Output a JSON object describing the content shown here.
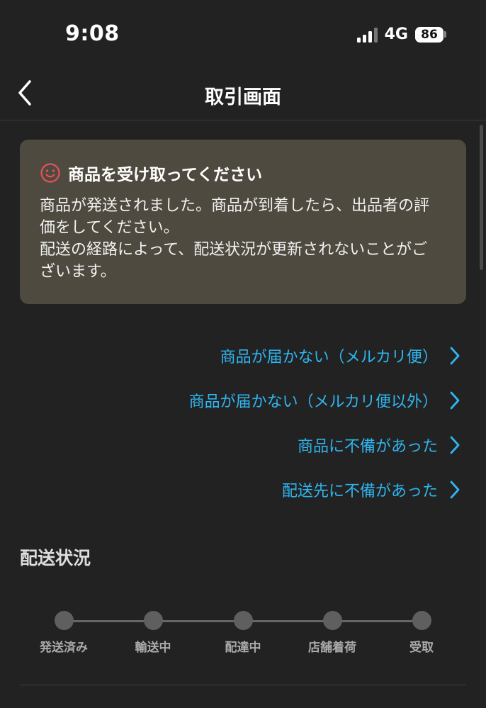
{
  "status": {
    "time": "9:08",
    "network": "4G",
    "battery": "86"
  },
  "nav": {
    "title": "取引画面"
  },
  "notice": {
    "title": "商品を受け取ってください",
    "body": "商品が発送されました。商品が到着したら、出品者の評\n価をしてください。\n配送の経路によって、配送状況が更新されないことがご\nざいます。",
    "icon": "smiley-icon",
    "icon_color": "#e8505b",
    "background": "#4e4a3f"
  },
  "links": [
    {
      "label": "商品が届かない（メルカリ便）"
    },
    {
      "label": "商品が届かない（メルカリ便以外）"
    },
    {
      "label": "商品に不備があった"
    },
    {
      "label": "配送先に不備があった"
    }
  ],
  "link_color": "#2fb5f0",
  "shipping": {
    "title": "配送状況",
    "steps": [
      {
        "label": "発送済み"
      },
      {
        "label": "輸送中"
      },
      {
        "label": "配達中"
      },
      {
        "label": "店舗着荷"
      },
      {
        "label": "受取"
      }
    ]
  }
}
